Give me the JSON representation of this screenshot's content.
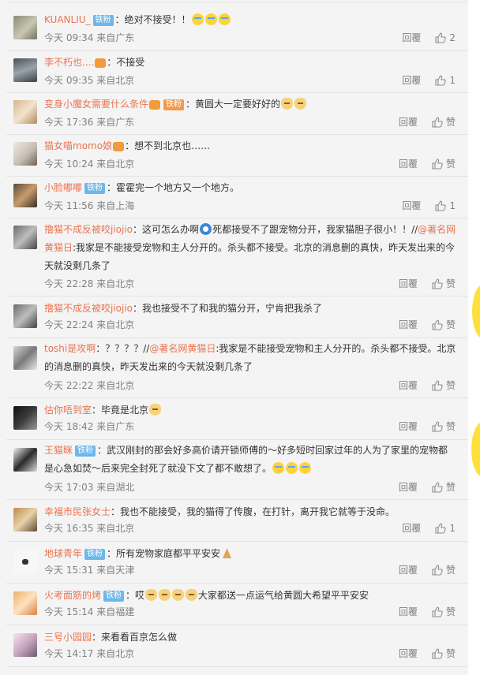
{
  "colors": {
    "username": "#eb7350",
    "meta": "#808080",
    "badge_iron": "#6eb7ea",
    "badge_fan": "#f29a4e",
    "side_accent": "#ffe03a"
  },
  "labels": {
    "reply": "回覆"
  },
  "comments": [
    {
      "username": "KUANLIU_",
      "badge": "铁粉",
      "segments": [
        {
          "type": "text",
          "text": "绝对不接受！！"
        }
      ],
      "emojis": [
        "cry",
        "cry",
        "cry"
      ],
      "time": "今天 09:34 来自广东",
      "likes": "2"
    },
    {
      "username": "李不朽也....",
      "badge": "",
      "segments": [
        {
          "type": "text",
          "text": "不接受"
        }
      ],
      "time": "今天 09:35 来自北京",
      "likes": "1"
    },
    {
      "username": "变身小魔女需要什么条件",
      "badge": "铁粉",
      "segments": [
        {
          "type": "text",
          "text": "黄圆大一定要好好的"
        }
      ],
      "emojis": [
        "cat",
        "cat"
      ],
      "time": "今天 17:36 来自广东",
      "likes": "赞"
    },
    {
      "username": "猫女喵momo娘",
      "badge": "",
      "segments": [
        {
          "type": "text",
          "text": "想不到北京也……"
        }
      ],
      "time": "今天 10:24 来自北京",
      "likes": "赞"
    },
    {
      "username": "小脸嘟嘟",
      "badge": "铁粉",
      "segments": [
        {
          "type": "text",
          "text": "霍霍完一个地方又一个地方。"
        }
      ],
      "time": "今天 11:56 来自上海",
      "likes": "1"
    },
    {
      "username": "撸猫不成反被咬jiojio",
      "badge": "",
      "text_1": "这可怎么办啊",
      "text_2": "死都接受不了跟宠物分开，我家猫胆子很小！！//",
      "mention": "@著名网黄猫日",
      "text_3": ":我家是不能接受宠物和主人分开的。杀头都不接受。北京的消息删的真快，昨天发出来的今天就没剩几条了",
      "time": "今天 22:28 来自北京",
      "likes": "赞"
    },
    {
      "username": "撸猫不成反被咬jiojio",
      "badge": "",
      "segments": [
        {
          "type": "text",
          "text": "我也接受不了和我的猫分开，宁肯把我杀了"
        }
      ],
      "time": "今天 22:24 来自北京",
      "likes": "赞"
    },
    {
      "username": "toshi是攻啊",
      "badge": "",
      "text_1": "？？？？//",
      "mention": "@著名网黄猫日",
      "text_3": ":我家是不能接受宠物和主人分开的。杀头都不接受。北京的消息删的真快，昨天发出来的今天就没剩几条了",
      "time": "今天 22:22 来自北京",
      "likes": "赞"
    },
    {
      "username": "估你唔到室",
      "badge": "",
      "segments": [
        {
          "type": "text",
          "text": "毕竟是北京"
        }
      ],
      "emojis": [
        "cat"
      ],
      "time": "今天 18:42 来自广东",
      "likes": "赞"
    },
    {
      "username": "王猫眯",
      "badge": "铁粉",
      "segments": [
        {
          "type": "text",
          "text": "武汉刚封的那会好多高价请开锁师傅的～好多短时回家过年的人为了家里的宠物都是心急如焚～后来完全封死了就没下文了都不敢想了。"
        }
      ],
      "emojis": [
        "cry",
        "cry",
        "cry"
      ],
      "time": "今天 17:03 来自湖北",
      "likes": "赞"
    },
    {
      "username": "幸福市民张女士",
      "badge": "",
      "segments": [
        {
          "type": "text",
          "text": "我也不能接受，我的猫得了传腹，在打针，离开我它就等于没命。"
        }
      ],
      "time": "今天 16:35 来自北京",
      "likes": "1"
    },
    {
      "username": "地球青年",
      "badge": "铁粉",
      "segments": [
        {
          "type": "text",
          "text": "所有宠物家庭都平平安安"
        }
      ],
      "emojis": [
        "pray"
      ],
      "time": "今天 15:31 来自天津",
      "likes": "赞"
    },
    {
      "username": "火考面筋的烤",
      "badge": "铁粉",
      "text_1": "哎",
      "text_2": "大家都送一点运气给黄圆大希望平平安安",
      "time": "今天 15:14 来自福建",
      "likes": "赞"
    },
    {
      "username": "三号小园园",
      "badge": "",
      "segments": [
        {
          "type": "text",
          "text": "来看看百京怎么做"
        }
      ],
      "time": "今天 14:17 来自北京",
      "likes": "赞"
    }
  ]
}
